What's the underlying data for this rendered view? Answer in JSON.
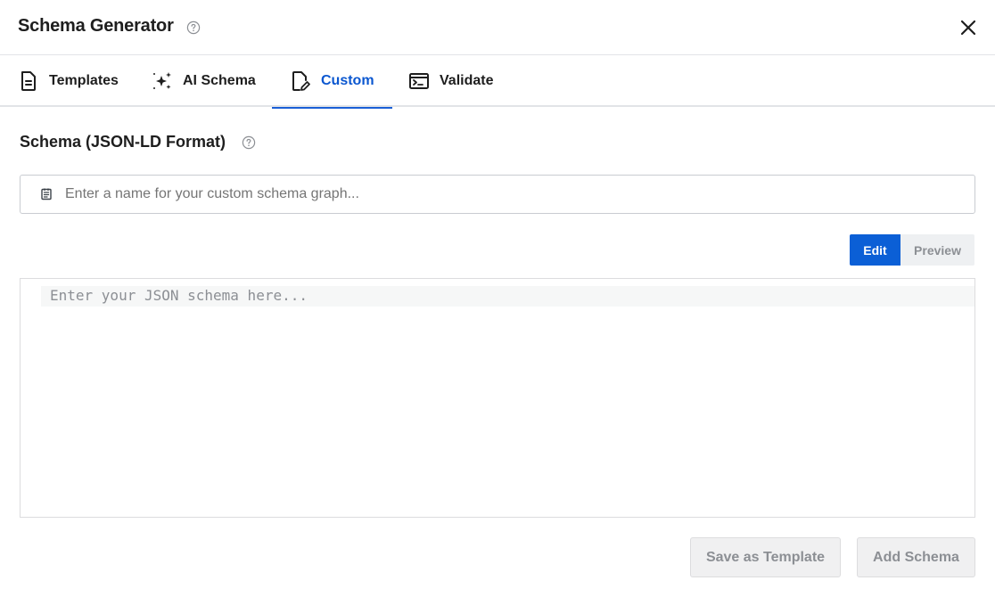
{
  "header": {
    "title": "Schema Generator"
  },
  "tabs": [
    {
      "label": "Templates",
      "icon": "document-icon",
      "active": false
    },
    {
      "label": "AI Schema",
      "icon": "sparkles-icon",
      "active": false
    },
    {
      "label": "Custom",
      "icon": "edit-document-icon",
      "active": true
    },
    {
      "label": "Validate",
      "icon": "terminal-icon",
      "active": false
    }
  ],
  "section": {
    "title": "Schema (JSON-LD Format)"
  },
  "name_input": {
    "value": "",
    "placeholder": "Enter a name for your custom schema graph..."
  },
  "mode_toggle": {
    "edit_label": "Edit",
    "preview_label": "Preview",
    "selected": "Edit"
  },
  "editor": {
    "value": "",
    "placeholder": "Enter your JSON schema here..."
  },
  "footer": {
    "save_template_label": "Save as Template",
    "add_schema_label": "Add Schema"
  },
  "colors": {
    "accent": "#0b5fd6",
    "active_tab_text": "#0b57d0",
    "disabled_text": "#8c8f94",
    "border": "#dcdcde"
  }
}
